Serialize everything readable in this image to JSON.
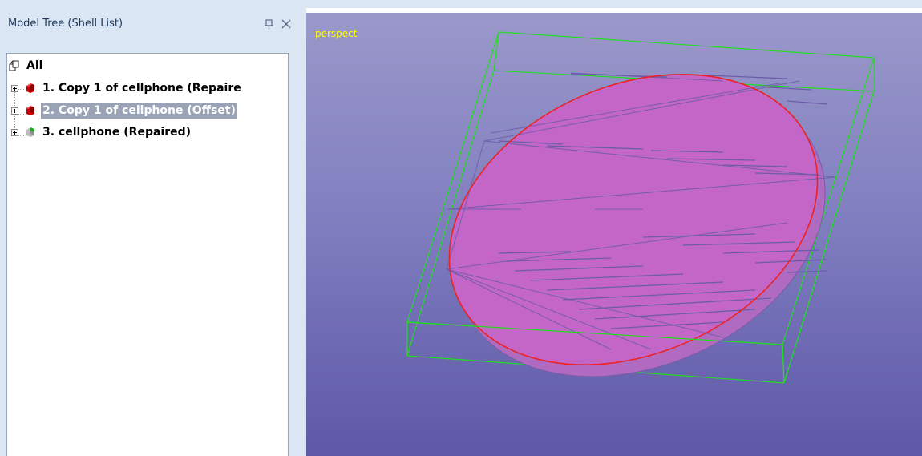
{
  "panel": {
    "title": "Model Tree (Shell List)",
    "pin_glyph": "、",
    "close_glyph": "✕"
  },
  "tree": {
    "root": {
      "label": "All",
      "icon": "shell-group-icon"
    },
    "items": [
      {
        "label": "1. Copy 1 of cellphone (Repaire",
        "icon": "red-shell-icon",
        "selected": false
      },
      {
        "label": "2. Copy 1 of cellphone (Offset)",
        "icon": "red-shell-icon",
        "selected": true
      },
      {
        "label": "3. cellphone (Repaired)",
        "icon": "green-shell-icon",
        "selected": false
      }
    ]
  },
  "viewport": {
    "mode_label": "perspect"
  },
  "colors": {
    "panel_bg": "#dbe6f4",
    "selection": "#99a3b5",
    "bounding_box": "#22dd22",
    "shell_fill": "#c466c8",
    "outline": "#ee2222",
    "mode_label": "#ffff00"
  }
}
